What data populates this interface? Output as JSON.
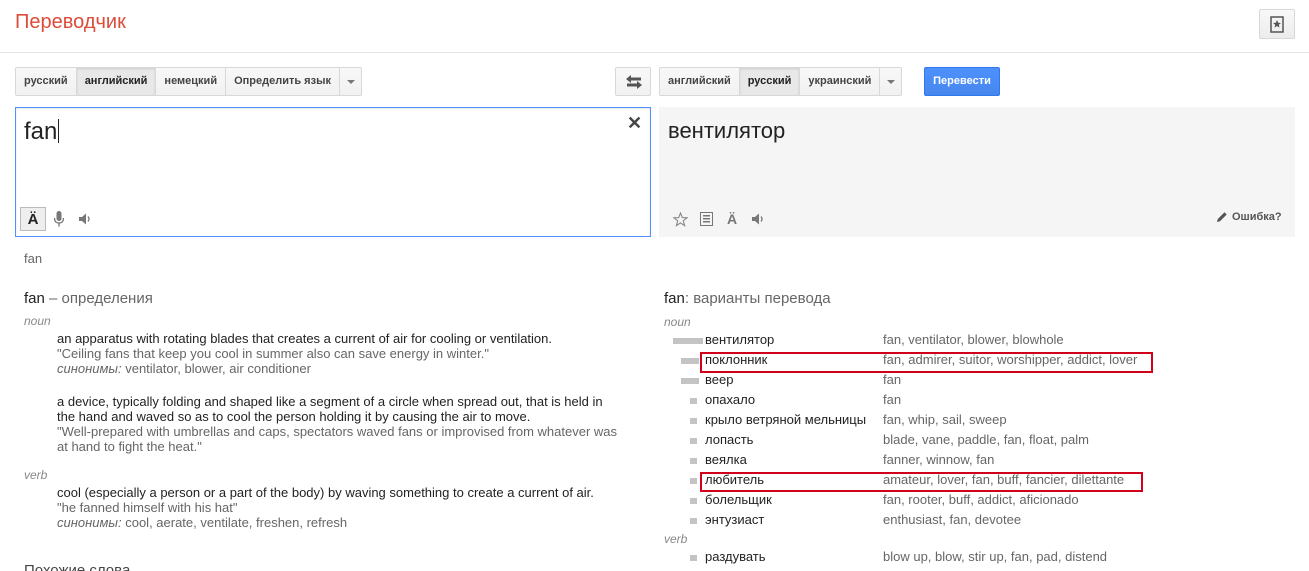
{
  "header": {
    "title": "Переводчик"
  },
  "source_langs": [
    "русский",
    "английский",
    "немецкий",
    "Определить язык"
  ],
  "source_selected": 1,
  "target_langs": [
    "английский",
    "русский",
    "украинский"
  ],
  "target_selected": 1,
  "translate_label": "Перевести",
  "source": {
    "text": "fan"
  },
  "target": {
    "text": "вентилятор",
    "wrong_label": "Ошибка?"
  },
  "source_echo": "fan",
  "definitions": {
    "word": "fan",
    "title_suffix": "– определения",
    "synonyms_label": "синонимы:",
    "noun": {
      "label": "noun",
      "entries": [
        {
          "definition": "an apparatus with rotating blades that creates a current of air for cooling or ventilation.",
          "example": "\"Ceiling fans that keep you cool in summer also can save energy in winter.\"",
          "synonyms": "ventilator, blower, air conditioner"
        },
        {
          "definition_lines": [
            "a device, typically folding and shaped like a segment of a circle when spread out, that is held in",
            "the hand and waved so as to cool the person holding it by causing the air to move."
          ],
          "example_lines": [
            "\"Well-prepared with umbrellas and caps, spectators waved fans or improvised from whatever was",
            "at hand to fight the heat.\""
          ]
        }
      ]
    },
    "verb": {
      "label": "verb",
      "definition": "cool (especially a person or a part of the body) by waving something to create a current of air.",
      "example": "\"he fanned himself with his hat\"",
      "synonyms": "cool, aerate, ventilate, freshen, refresh"
    }
  },
  "similar_title": "Похожие слова",
  "variants": {
    "word": "fan",
    "title_suffix": ": варианты перевода",
    "noun_label": "noun",
    "noun": [
      {
        "word": "вентилятор",
        "synonyms": "fan, ventilator, blower, blowhole",
        "frequency": 3
      },
      {
        "word": "поклонник",
        "synonyms": "fan, admirer, suitor, worshipper, addict, lover",
        "frequency": 2
      },
      {
        "word": "веер",
        "synonyms": "fan",
        "frequency": 2
      },
      {
        "word": "опахало",
        "synonyms": "fan",
        "frequency": 1
      },
      {
        "word": "крыло ветряной мельницы",
        "synonyms": "fan, whip, sail, sweep",
        "frequency": 1
      },
      {
        "word": "лопасть",
        "synonyms": "blade, vane, paddle, fan, float, palm",
        "frequency": 1
      },
      {
        "word": "веялка",
        "synonyms": "fanner, winnow, fan",
        "frequency": 1
      },
      {
        "word": "любитель",
        "synonyms": "amateur, lover, fan, buff, fancier, dilettante",
        "frequency": 1
      },
      {
        "word": "болельщик",
        "synonyms": "fan, rooter, buff, addict, aficionado",
        "frequency": 1
      },
      {
        "word": "энтузиаст",
        "synonyms": "enthusiast, fan, devotee",
        "frequency": 1
      }
    ],
    "verb_label": "verb",
    "verb": [
      {
        "word": "раздувать",
        "synonyms": "blow up, blow, stir up, fan, pad, distend",
        "frequency": 1
      }
    ]
  },
  "colors": {
    "brand": "#dd4b39",
    "accent": "#4d90fe",
    "highlight": "#d0021b"
  }
}
